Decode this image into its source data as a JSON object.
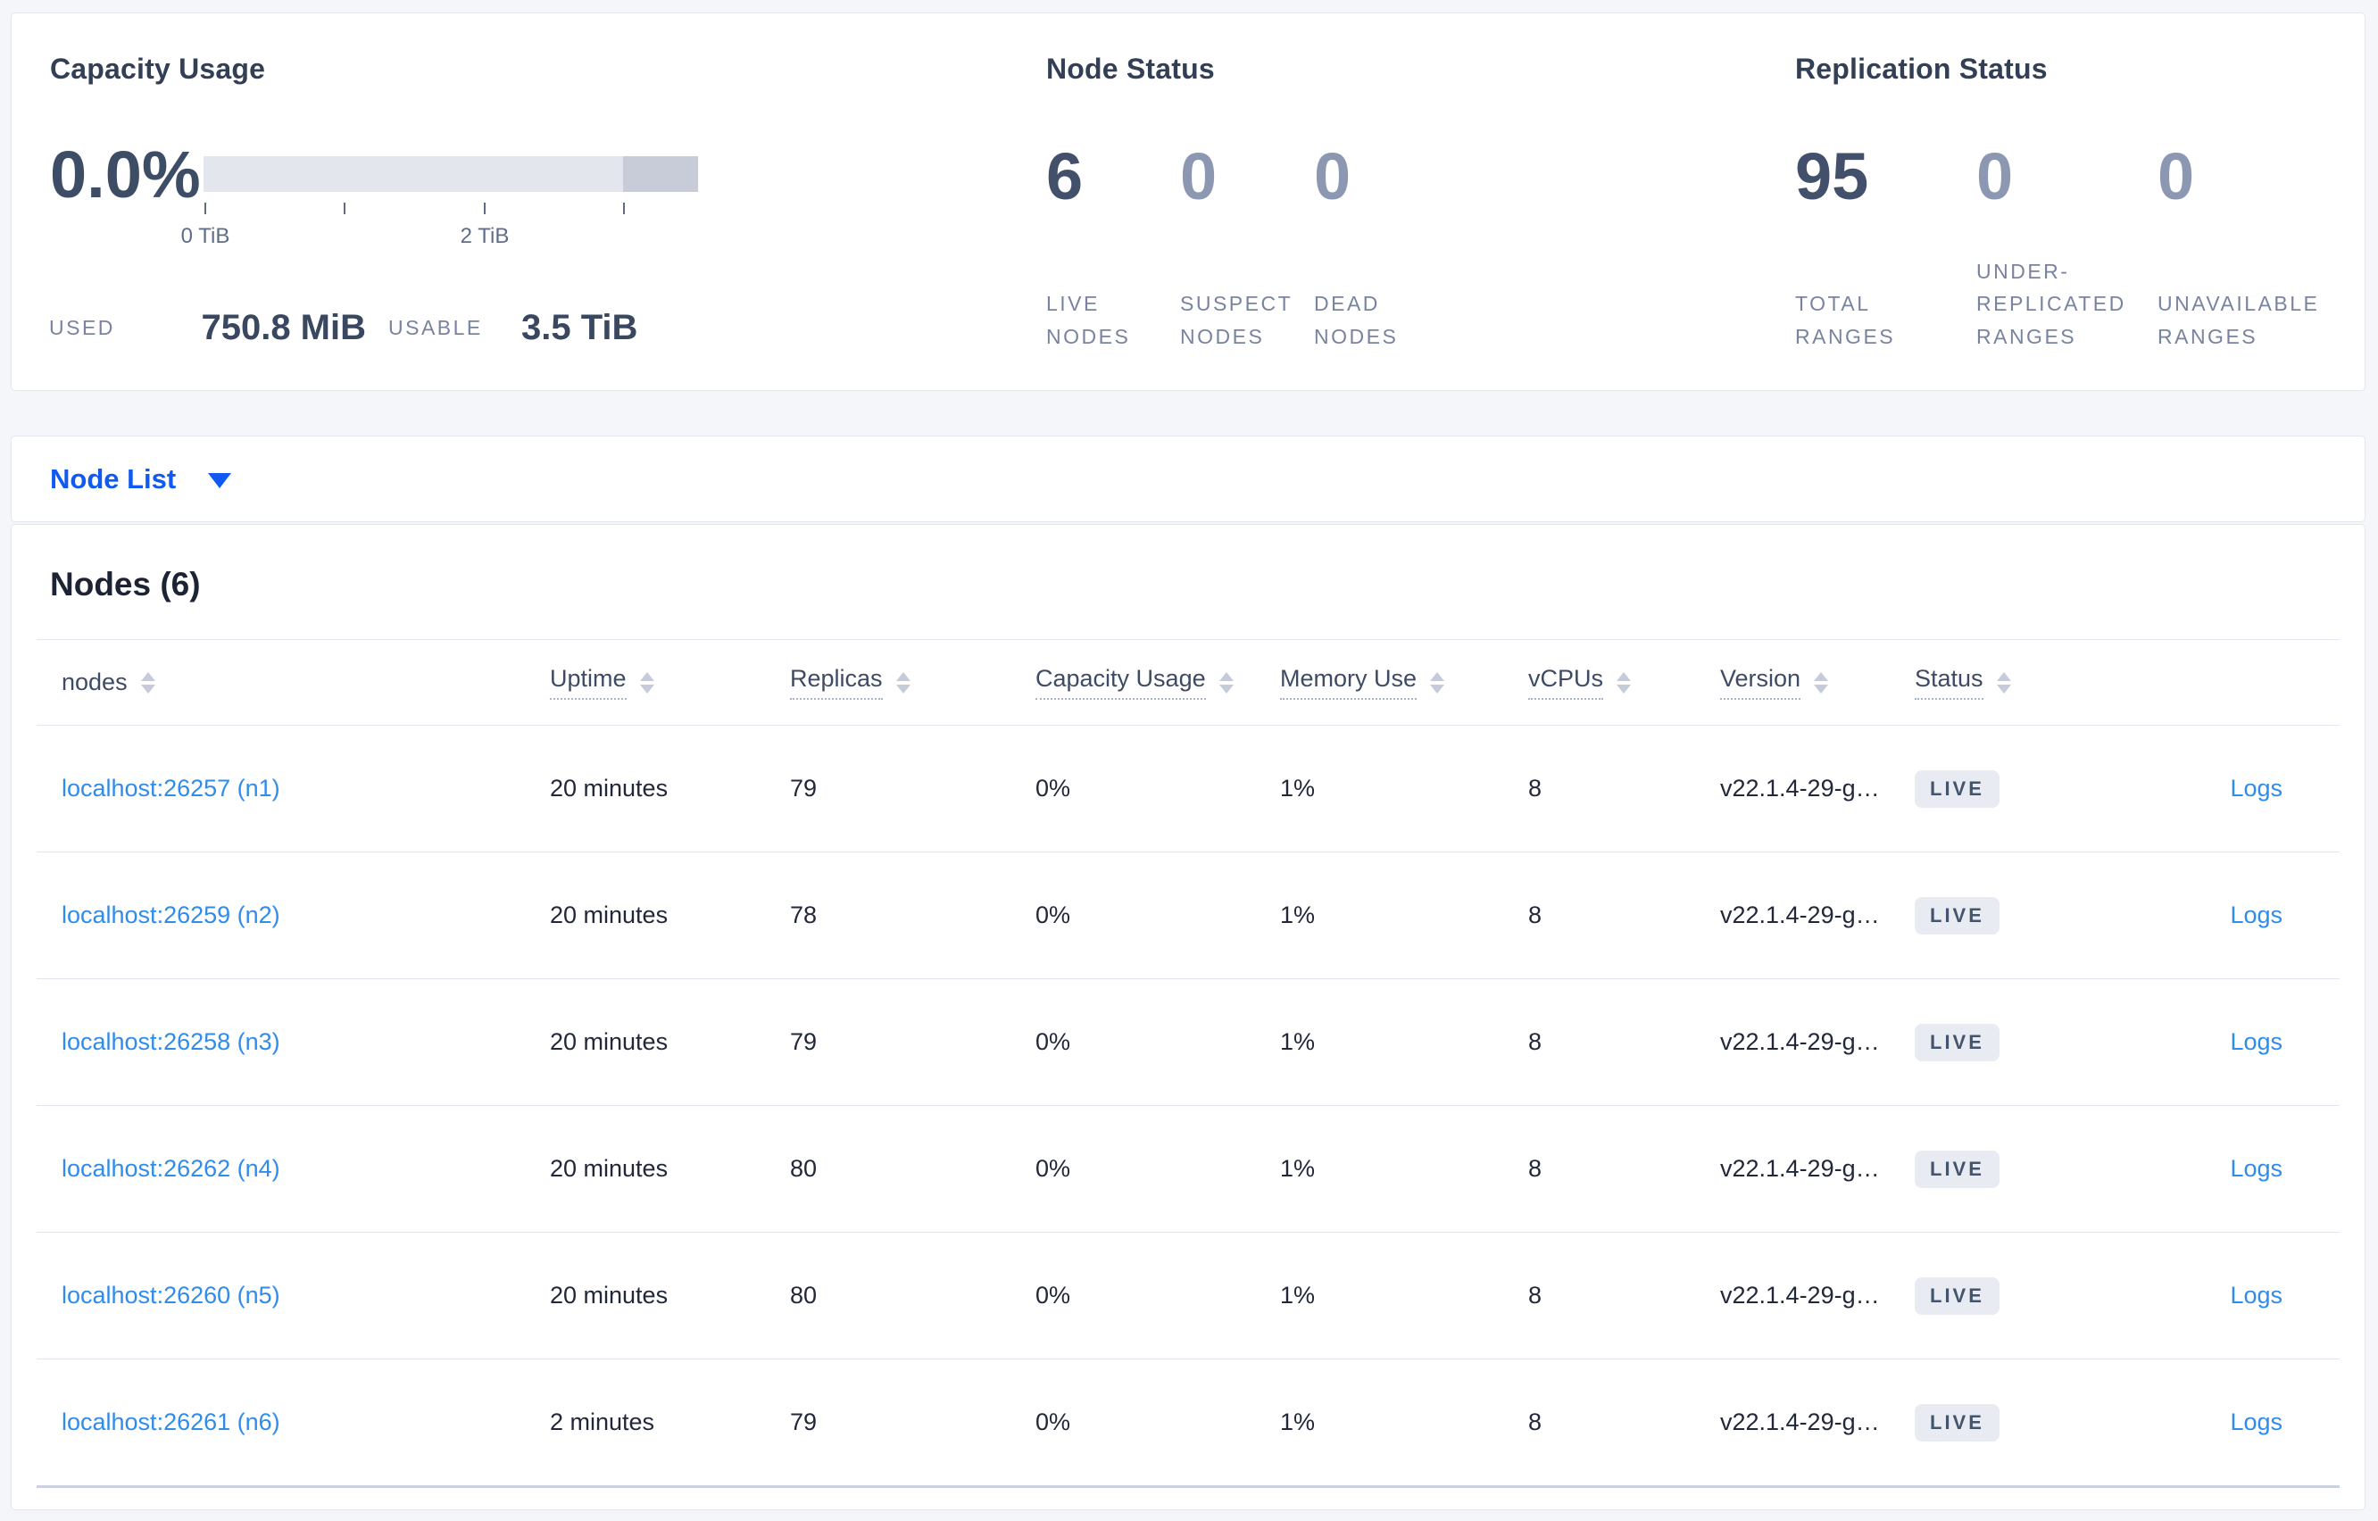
{
  "summary": {
    "capacity": {
      "title": "Capacity Usage",
      "percent": "0.0%",
      "axis_ticks": [
        "0 TiB",
        "2 TiB"
      ],
      "used_label": "USED",
      "used_value": "750.8 MiB",
      "usable_label": "USABLE",
      "usable_value": "3.5 TiB"
    },
    "node_status": {
      "title": "Node Status",
      "stats": [
        {
          "value": "6",
          "label": "LIVE NODES",
          "emphasis": "primary"
        },
        {
          "value": "0",
          "label": "SUSPECT NODES",
          "emphasis": "secondary"
        },
        {
          "value": "0",
          "label": "DEAD NODES",
          "emphasis": "secondary"
        }
      ]
    },
    "replication_status": {
      "title": "Replication Status",
      "stats": [
        {
          "value": "95",
          "label": "TOTAL RANGES",
          "emphasis": "primary"
        },
        {
          "value": "0",
          "label": "UNDER-REPLICATED RANGES",
          "emphasis": "secondary"
        },
        {
          "value": "0",
          "label": "UNAVAILABLE RANGES",
          "emphasis": "secondary"
        }
      ]
    }
  },
  "node_list": {
    "label": "Node List"
  },
  "nodes_table": {
    "title": "Nodes (6)",
    "logs_label": "Logs",
    "columns": [
      {
        "label": "nodes",
        "underlined": false
      },
      {
        "label": "Uptime",
        "underlined": true
      },
      {
        "label": "Replicas",
        "underlined": true
      },
      {
        "label": "Capacity Usage",
        "underlined": true
      },
      {
        "label": "Memory Use",
        "underlined": true
      },
      {
        "label": "vCPUs",
        "underlined": true
      },
      {
        "label": "Version",
        "underlined": true
      },
      {
        "label": "Status",
        "underlined": true
      }
    ],
    "rows": [
      {
        "address": "localhost:26257 (n1)",
        "uptime": "20 minutes",
        "replicas": "79",
        "capacity": "0%",
        "memory": "1%",
        "vcpus": "8",
        "version": "v22.1.4-29-g…",
        "status": "LIVE"
      },
      {
        "address": "localhost:26259 (n2)",
        "uptime": "20 minutes",
        "replicas": "78",
        "capacity": "0%",
        "memory": "1%",
        "vcpus": "8",
        "version": "v22.1.4-29-g…",
        "status": "LIVE"
      },
      {
        "address": "localhost:26258 (n3)",
        "uptime": "20 minutes",
        "replicas": "79",
        "capacity": "0%",
        "memory": "1%",
        "vcpus": "8",
        "version": "v22.1.4-29-g…",
        "status": "LIVE"
      },
      {
        "address": "localhost:26262 (n4)",
        "uptime": "20 minutes",
        "replicas": "80",
        "capacity": "0%",
        "memory": "1%",
        "vcpus": "8",
        "version": "v22.1.4-29-g…",
        "status": "LIVE"
      },
      {
        "address": "localhost:26260 (n5)",
        "uptime": "20 minutes",
        "replicas": "80",
        "capacity": "0%",
        "memory": "1%",
        "vcpus": "8",
        "version": "v22.1.4-29-g…",
        "status": "LIVE"
      },
      {
        "address": "localhost:26261 (n6)",
        "uptime": "2 minutes",
        "replicas": "79",
        "capacity": "0%",
        "memory": "1%",
        "vcpus": "8",
        "version": "v22.1.4-29-g…",
        "status": "LIVE"
      }
    ]
  },
  "colors": {
    "accent_blue": "#1059f2",
    "link_blue": "#2f8ceb",
    "bar_track": "#e3e6ed",
    "bar_highlight": "#c8ccd9",
    "primary_number": "#43506b",
    "secondary_number": "#8c97b2"
  }
}
